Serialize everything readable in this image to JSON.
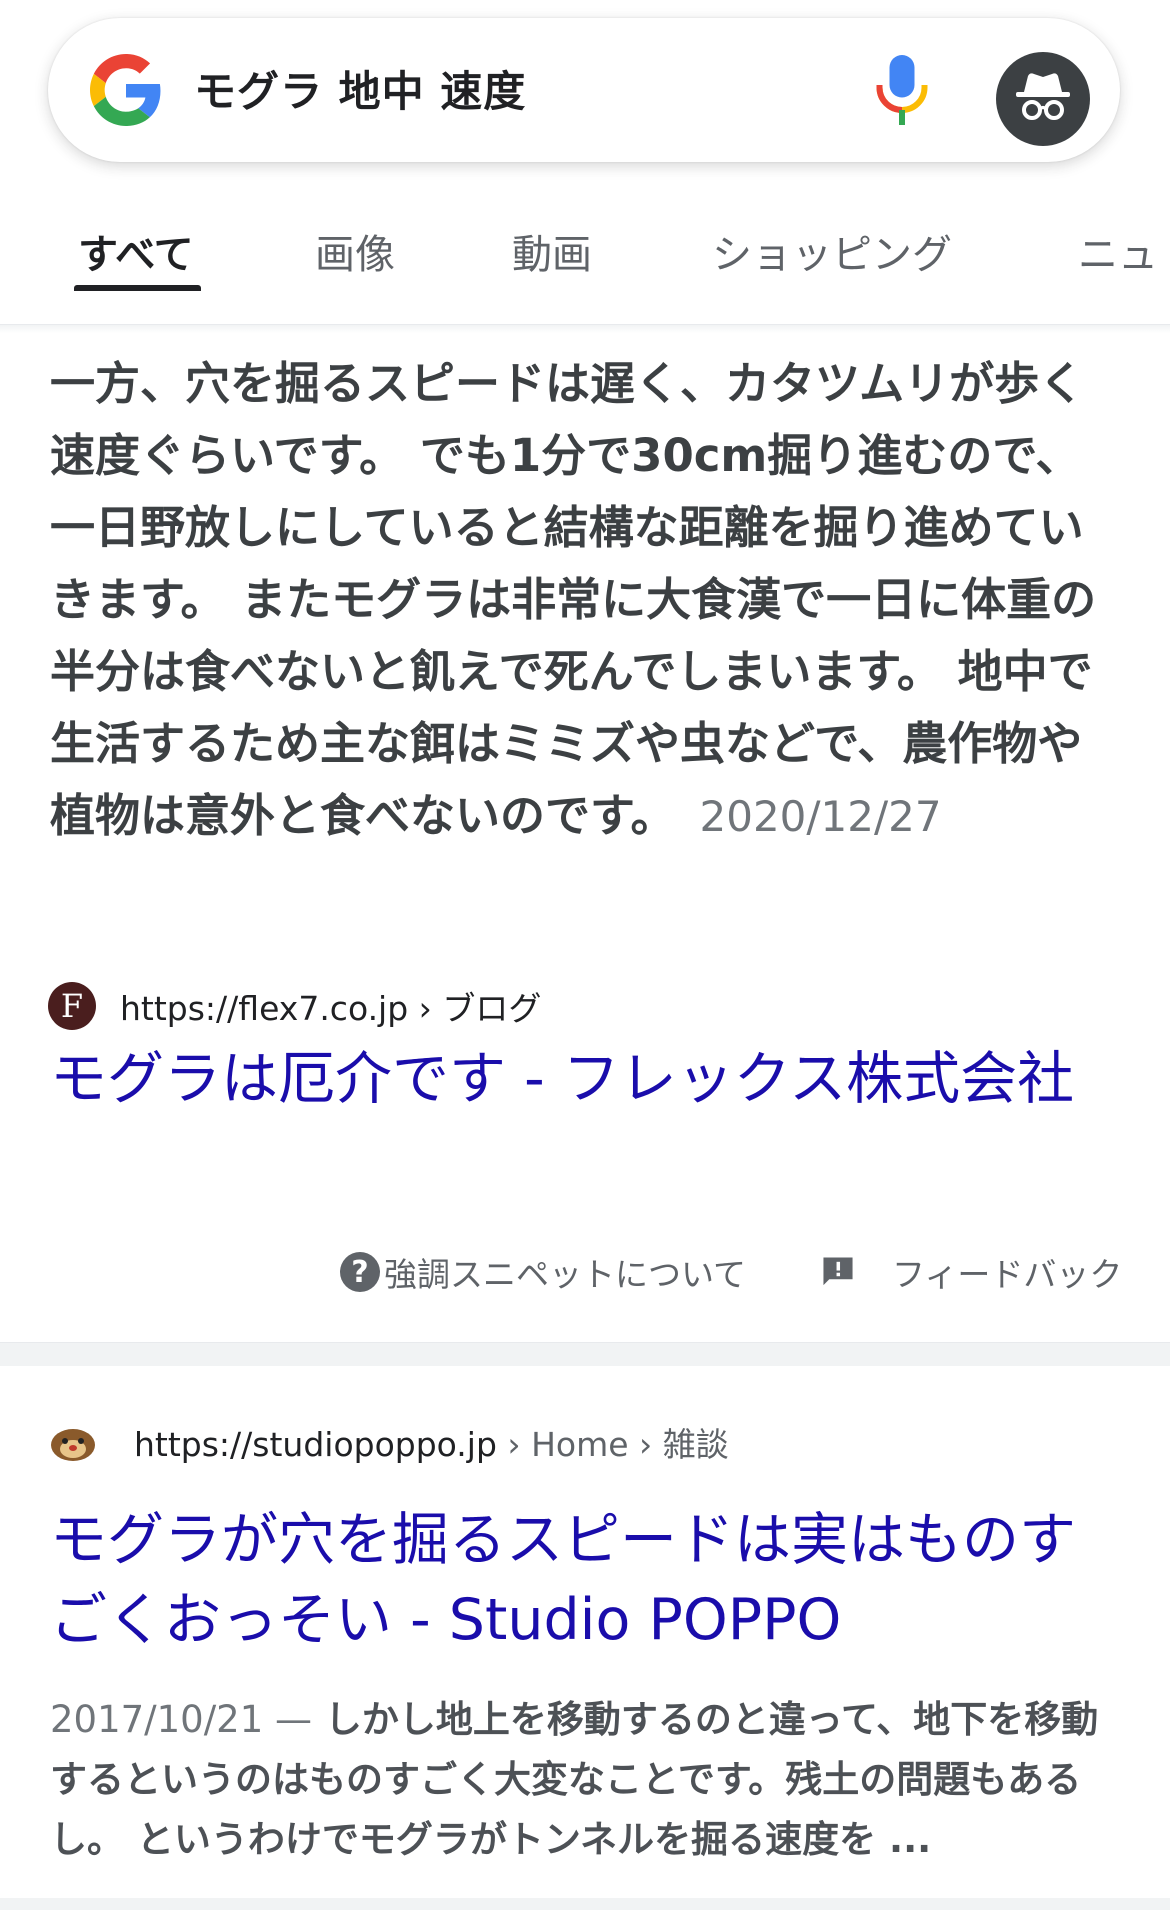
{
  "search": {
    "query": "モグラ 地中 速度"
  },
  "tabs": [
    {
      "label": "すべて"
    },
    {
      "label": "画像"
    },
    {
      "label": "動画"
    },
    {
      "label": "ショッピング"
    },
    {
      "label": "ニュ"
    }
  ],
  "featured_snippet": {
    "text": "一方、穴を掘るスピードは遅く、カタツムリが歩く速度ぐらいです。 でも1分で30cm掘り進むので、一日野放しにしていると結構な距離を掘り進めていきます。 またモグラは非常に大食漢で一日に体重の半分は食べないと飢えで死んでしまいます。 地中で生活するため主な餌はミミズや虫などで、農作物や植物は意外と食べないのです。",
    "date": "2020/12/27",
    "source_url": "https://flex7.co.jp",
    "breadcrumb": "› ブログ",
    "title": "モグラは厄介です - フレックス株式会社",
    "about_label": "強調スニペットについて",
    "feedback_label": "フィードバック"
  },
  "result2": {
    "url": "https://studiopoppo.jp",
    "breadcrumb": " › Home › 雑談",
    "title": "モグラが穴を掘るスピードは実はものすごくおっそい - Studio POPPO",
    "date": "2017/10/21 —",
    "snippet": " しかし地上を移動するのと違って、地下を移動するというのはものすごく大変なことです。残土の問題もあるし。 というわけでモグラがトンネルを掘る速度を ..."
  },
  "colors": {
    "link": "#1a0dab",
    "text": "#202124",
    "muted": "#5f6368"
  }
}
